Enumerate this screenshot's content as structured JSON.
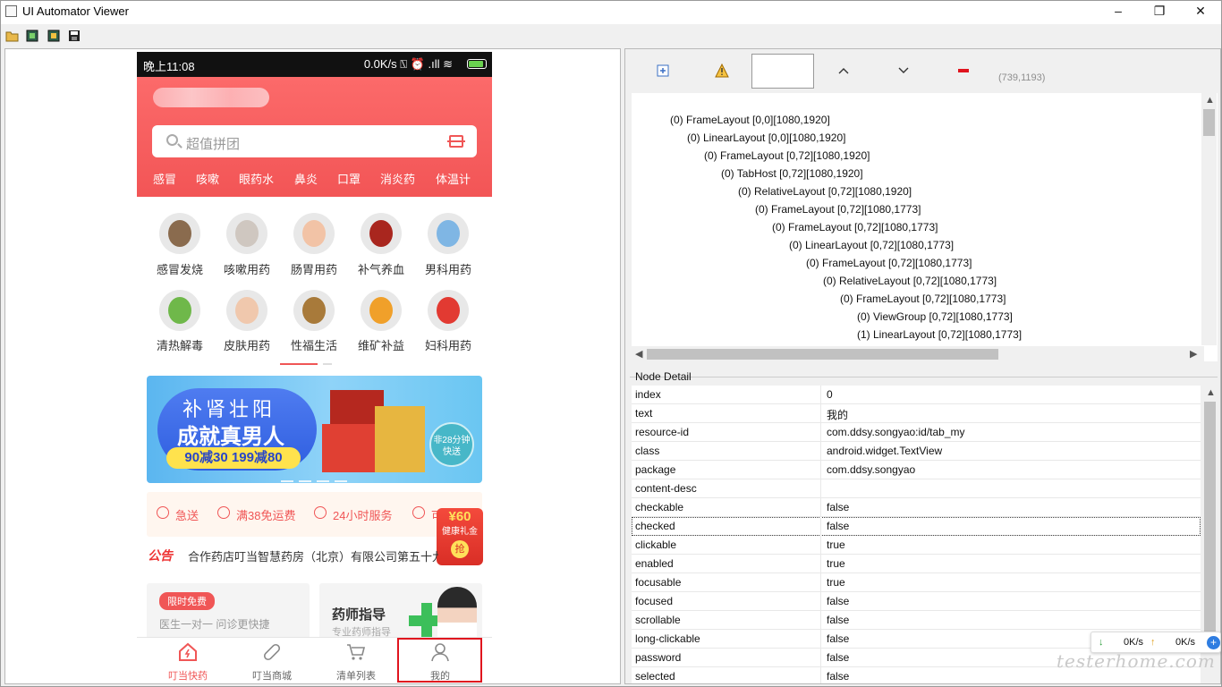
{
  "window": {
    "title": "UI Automator Viewer",
    "min": "–",
    "max": "❐",
    "close": "✕"
  },
  "phone": {
    "status": {
      "time": "晚上11:08",
      "right": "0.0K/s ⍂ ⏰ .ıll ≋"
    },
    "search_placeholder": "超值拼团",
    "keywords": [
      "感冒",
      "咳嗽",
      "眼药水",
      "鼻炎",
      "口罩",
      "消炎药",
      "体温计"
    ],
    "categories": [
      "感冒发烧",
      "咳嗽用药",
      "肠胃用药",
      "补气养血",
      "男科用药",
      "清热解毒",
      "皮肤用药",
      "性福生活",
      "维矿补益",
      "妇科用药"
    ],
    "banner": {
      "line1": "补肾壮阳",
      "line2": "成就真男人",
      "line3": "90减30 199减80",
      "badge": "非28分钟快送"
    },
    "services": [
      "急送",
      "满38免运费",
      "24小时服务",
      "可"
    ],
    "gift": {
      "price": "¥60",
      "name": "健康礼金",
      "grab": "抢"
    },
    "notice_tag": "公告",
    "notice": "合作药店叮当智慧药房（北京）有限公司第五十九",
    "card1": {
      "tag": "限时免费",
      "sub": "医生一对一  问诊更快捷"
    },
    "card2": {
      "title": "药师指导",
      "sub": "专业药师指导"
    },
    "tabs": [
      "叮当快药",
      "叮当商城",
      "清单列表",
      "我的"
    ]
  },
  "coords": "(739,1193)",
  "tree": [
    "(0) FrameLayout [0,0][1080,1920]",
    "(0) LinearLayout [0,0][1080,1920]",
    "(0) FrameLayout [0,72][1080,1920]",
    "(0) TabHost [0,72][1080,1920]",
    "(0) RelativeLayout [0,72][1080,1920]",
    "(0) FrameLayout [0,72][1080,1773]",
    "(0) FrameLayout [0,72][1080,1773]",
    "(0) LinearLayout [0,72][1080,1773]",
    "(0) FrameLayout [0,72][1080,1773]",
    "(0) RelativeLayout [0,72][1080,1773]",
    "(0) FrameLayout [0,72][1080,1773]",
    "(0) ViewGroup [0,72][1080,1773]",
    "(1) LinearLayout [0,72][1080,1773]"
  ],
  "node_detail_title": "Node Detail",
  "node_detail": [
    {
      "k": "index",
      "v": "0"
    },
    {
      "k": "text",
      "v": "我的"
    },
    {
      "k": "resource-id",
      "v": "com.ddsy.songyao:id/tab_my"
    },
    {
      "k": "class",
      "v": "android.widget.TextView"
    },
    {
      "k": "package",
      "v": "com.ddsy.songyao"
    },
    {
      "k": "content-desc",
      "v": ""
    },
    {
      "k": "checkable",
      "v": "false"
    },
    {
      "k": "checked",
      "v": "false"
    },
    {
      "k": "clickable",
      "v": "true"
    },
    {
      "k": "enabled",
      "v": "true"
    },
    {
      "k": "focusable",
      "v": "true"
    },
    {
      "k": "focused",
      "v": "false"
    },
    {
      "k": "scrollable",
      "v": "false"
    },
    {
      "k": "long-clickable",
      "v": "false"
    },
    {
      "k": "password",
      "v": "false"
    },
    {
      "k": "selected",
      "v": "false"
    }
  ],
  "net": {
    "down": "0K/s",
    "up": "0K/s"
  },
  "watermark": "testerhome.com",
  "colors": {
    "accent": "#f05656",
    "selection": "#e0141e"
  }
}
